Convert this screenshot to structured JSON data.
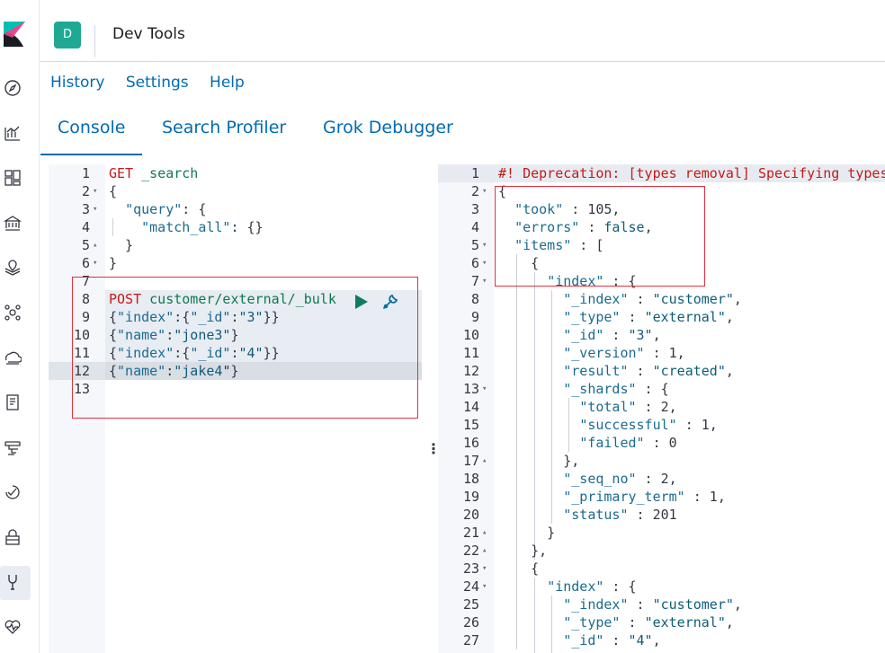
{
  "header": {
    "avatar_letter": "D",
    "title": "Dev Tools"
  },
  "menu": {
    "history": "History",
    "settings": "Settings",
    "help": "Help"
  },
  "tabs": {
    "console": "Console",
    "search_profiler": "Search Profiler",
    "grok_debugger": "Grok Debugger"
  },
  "nav_icons": [
    "compass-icon",
    "visualize-icon",
    "dashboard-icon",
    "canvas-icon",
    "maps-icon",
    "ml-icon",
    "infrastructure-icon",
    "logs-icon",
    "apm-icon",
    "uptime-icon",
    "security-icon",
    "devtools-icon",
    "monitoring-icon"
  ],
  "request_editor": {
    "lines": [
      {
        "n": "1",
        "fold": "",
        "segments": [
          {
            "t": "GET ",
            "c": "k-method"
          },
          {
            "t": "_search",
            "c": "k-path"
          }
        ]
      },
      {
        "n": "2",
        "fold": "▾",
        "segments": [
          {
            "t": "{",
            "c": "k-plain"
          }
        ]
      },
      {
        "n": "3",
        "fold": "▾",
        "segments": [
          {
            "t": "  ",
            "c": "k-plain"
          },
          {
            "t": "\"query\"",
            "c": "k-key"
          },
          {
            "t": ": {",
            "c": "k-plain"
          }
        ]
      },
      {
        "n": "4",
        "fold": "",
        "segments": [
          {
            "t": "    ",
            "c": "k-plain"
          },
          {
            "t": "\"match_all\"",
            "c": "k-key"
          },
          {
            "t": ": {}",
            "c": "k-plain"
          }
        ]
      },
      {
        "n": "5",
        "fold": "▴",
        "segments": [
          {
            "t": "  }",
            "c": "k-plain"
          }
        ]
      },
      {
        "n": "6",
        "fold": "▾",
        "segments": [
          {
            "t": "}",
            "c": "k-plain"
          }
        ]
      },
      {
        "n": "7",
        "fold": "",
        "segments": []
      },
      {
        "n": "8",
        "fold": "",
        "segments": [
          {
            "t": "POST ",
            "c": "k-method"
          },
          {
            "t": "customer/external/_bulk",
            "c": "k-path"
          }
        ]
      },
      {
        "n": "9",
        "fold": "",
        "segments": [
          {
            "t": "{",
            "c": "k-plain"
          },
          {
            "t": "\"index\"",
            "c": "k-key"
          },
          {
            "t": ":{",
            "c": "k-plain"
          },
          {
            "t": "\"_id\"",
            "c": "k-key"
          },
          {
            "t": ":",
            "c": "k-plain"
          },
          {
            "t": "\"3\"",
            "c": "k-val"
          },
          {
            "t": "}}",
            "c": "k-plain"
          }
        ]
      },
      {
        "n": "10",
        "fold": "",
        "segments": [
          {
            "t": "{",
            "c": "k-plain"
          },
          {
            "t": "\"name\"",
            "c": "k-key"
          },
          {
            "t": ":",
            "c": "k-plain"
          },
          {
            "t": "\"jone3\"",
            "c": "k-val"
          },
          {
            "t": "}",
            "c": "k-plain"
          }
        ]
      },
      {
        "n": "11",
        "fold": "",
        "segments": [
          {
            "t": "{",
            "c": "k-plain"
          },
          {
            "t": "\"index\"",
            "c": "k-key"
          },
          {
            "t": ":{",
            "c": "k-plain"
          },
          {
            "t": "\"_id\"",
            "c": "k-key"
          },
          {
            "t": ":",
            "c": "k-plain"
          },
          {
            "t": "\"4\"",
            "c": "k-val"
          },
          {
            "t": "}}",
            "c": "k-plain"
          }
        ]
      },
      {
        "n": "12",
        "fold": "",
        "segments": [
          {
            "t": "{",
            "c": "k-plain"
          },
          {
            "t": "\"name\"",
            "c": "k-key"
          },
          {
            "t": ":",
            "c": "k-plain"
          },
          {
            "t": "\"jake4",
            "c": "k-val"
          },
          {
            "t": "\"}",
            "c": "k-plain"
          }
        ]
      },
      {
        "n": "13",
        "fold": "",
        "segments": []
      }
    ]
  },
  "response_editor": {
    "lines": [
      {
        "n": "1",
        "fold": "",
        "segments": [
          {
            "t": "#! Deprecation: [types removal] Specifying types",
            "c": "k-comment"
          }
        ]
      },
      {
        "n": "2",
        "fold": "▾",
        "segments": [
          {
            "t": "{",
            "c": "k-plain"
          }
        ]
      },
      {
        "n": "3",
        "fold": "",
        "segments": [
          {
            "t": "  ",
            "c": "k-plain"
          },
          {
            "t": "\"took\"",
            "c": "k-key"
          },
          {
            "t": " : 105,",
            "c": "k-plain"
          }
        ]
      },
      {
        "n": "4",
        "fold": "",
        "segments": [
          {
            "t": "  ",
            "c": "k-plain"
          },
          {
            "t": "\"errors\"",
            "c": "k-key"
          },
          {
            "t": " : ",
            "c": "k-plain"
          },
          {
            "t": "false",
            "c": "k-val"
          },
          {
            "t": ",",
            "c": "k-plain"
          }
        ]
      },
      {
        "n": "5",
        "fold": "▾",
        "segments": [
          {
            "t": "  ",
            "c": "k-plain"
          },
          {
            "t": "\"items\"",
            "c": "k-key"
          },
          {
            "t": " : [",
            "c": "k-plain"
          }
        ]
      },
      {
        "n": "6",
        "fold": "▾",
        "segments": [
          {
            "t": "    {",
            "c": "k-plain"
          }
        ]
      },
      {
        "n": "7",
        "fold": "▾",
        "segments": [
          {
            "t": "      ",
            "c": "k-plain"
          },
          {
            "t": "\"index\"",
            "c": "k-key"
          },
          {
            "t": " : {",
            "c": "k-plain"
          }
        ]
      },
      {
        "n": "8",
        "fold": "",
        "segments": [
          {
            "t": "        ",
            "c": "k-plain"
          },
          {
            "t": "\"_index\"",
            "c": "k-key"
          },
          {
            "t": " : ",
            "c": "k-plain"
          },
          {
            "t": "\"customer\"",
            "c": "k-val"
          },
          {
            "t": ",",
            "c": "k-plain"
          }
        ]
      },
      {
        "n": "9",
        "fold": "",
        "segments": [
          {
            "t": "        ",
            "c": "k-plain"
          },
          {
            "t": "\"_type\"",
            "c": "k-key"
          },
          {
            "t": " : ",
            "c": "k-plain"
          },
          {
            "t": "\"external\"",
            "c": "k-val"
          },
          {
            "t": ",",
            "c": "k-plain"
          }
        ]
      },
      {
        "n": "10",
        "fold": "",
        "segments": [
          {
            "t": "        ",
            "c": "k-plain"
          },
          {
            "t": "\"_id\"",
            "c": "k-key"
          },
          {
            "t": " : ",
            "c": "k-plain"
          },
          {
            "t": "\"3\"",
            "c": "k-val"
          },
          {
            "t": ",",
            "c": "k-plain"
          }
        ]
      },
      {
        "n": "11",
        "fold": "",
        "segments": [
          {
            "t": "        ",
            "c": "k-plain"
          },
          {
            "t": "\"_version\"",
            "c": "k-key"
          },
          {
            "t": " : 1,",
            "c": "k-plain"
          }
        ]
      },
      {
        "n": "12",
        "fold": "",
        "segments": [
          {
            "t": "        ",
            "c": "k-plain"
          },
          {
            "t": "\"result\"",
            "c": "k-key"
          },
          {
            "t": " : ",
            "c": "k-plain"
          },
          {
            "t": "\"created\"",
            "c": "k-val"
          },
          {
            "t": ",",
            "c": "k-plain"
          }
        ]
      },
      {
        "n": "13",
        "fold": "▾",
        "segments": [
          {
            "t": "        ",
            "c": "k-plain"
          },
          {
            "t": "\"_shards\"",
            "c": "k-key"
          },
          {
            "t": " : {",
            "c": "k-plain"
          }
        ]
      },
      {
        "n": "14",
        "fold": "",
        "segments": [
          {
            "t": "          ",
            "c": "k-plain"
          },
          {
            "t": "\"total\"",
            "c": "k-key"
          },
          {
            "t": " : 2,",
            "c": "k-plain"
          }
        ]
      },
      {
        "n": "15",
        "fold": "",
        "segments": [
          {
            "t": "          ",
            "c": "k-plain"
          },
          {
            "t": "\"successful\"",
            "c": "k-key"
          },
          {
            "t": " : 1,",
            "c": "k-plain"
          }
        ]
      },
      {
        "n": "16",
        "fold": "",
        "segments": [
          {
            "t": "          ",
            "c": "k-plain"
          },
          {
            "t": "\"failed\"",
            "c": "k-key"
          },
          {
            "t": " : 0",
            "c": "k-plain"
          }
        ]
      },
      {
        "n": "17",
        "fold": "▴",
        "segments": [
          {
            "t": "        },",
            "c": "k-plain"
          }
        ]
      },
      {
        "n": "18",
        "fold": "",
        "segments": [
          {
            "t": "        ",
            "c": "k-plain"
          },
          {
            "t": "\"_seq_no\"",
            "c": "k-key"
          },
          {
            "t": " : 2,",
            "c": "k-plain"
          }
        ]
      },
      {
        "n": "19",
        "fold": "",
        "segments": [
          {
            "t": "        ",
            "c": "k-plain"
          },
          {
            "t": "\"_primary_term\"",
            "c": "k-key"
          },
          {
            "t": " : 1,",
            "c": "k-plain"
          }
        ]
      },
      {
        "n": "20",
        "fold": "",
        "segments": [
          {
            "t": "        ",
            "c": "k-plain"
          },
          {
            "t": "\"status\"",
            "c": "k-key"
          },
          {
            "t": " : 201",
            "c": "k-plain"
          }
        ]
      },
      {
        "n": "21",
        "fold": "▴",
        "segments": [
          {
            "t": "      }",
            "c": "k-plain"
          }
        ]
      },
      {
        "n": "22",
        "fold": "▴",
        "segments": [
          {
            "t": "    },",
            "c": "k-plain"
          }
        ]
      },
      {
        "n": "23",
        "fold": "▾",
        "segments": [
          {
            "t": "    {",
            "c": "k-plain"
          }
        ]
      },
      {
        "n": "24",
        "fold": "▾",
        "segments": [
          {
            "t": "      ",
            "c": "k-plain"
          },
          {
            "t": "\"index\"",
            "c": "k-key"
          },
          {
            "t": " : {",
            "c": "k-plain"
          }
        ]
      },
      {
        "n": "25",
        "fold": "",
        "segments": [
          {
            "t": "        ",
            "c": "k-plain"
          },
          {
            "t": "\"_index\"",
            "c": "k-key"
          },
          {
            "t": " : ",
            "c": "k-plain"
          },
          {
            "t": "\"customer\"",
            "c": "k-val"
          },
          {
            "t": ",",
            "c": "k-plain"
          }
        ]
      },
      {
        "n": "26",
        "fold": "",
        "segments": [
          {
            "t": "        ",
            "c": "k-plain"
          },
          {
            "t": "\"_type\"",
            "c": "k-key"
          },
          {
            "t": " : ",
            "c": "k-plain"
          },
          {
            "t": "\"external\"",
            "c": "k-val"
          },
          {
            "t": ",",
            "c": "k-plain"
          }
        ]
      },
      {
        "n": "27",
        "fold": "",
        "segments": [
          {
            "t": "        ",
            "c": "k-plain"
          },
          {
            "t": "\"_id\"",
            "c": "k-key"
          },
          {
            "t": " : ",
            "c": "k-plain"
          },
          {
            "t": "\"4\"",
            "c": "k-val"
          },
          {
            "t": ",",
            "c": "k-plain"
          }
        ]
      }
    ]
  }
}
